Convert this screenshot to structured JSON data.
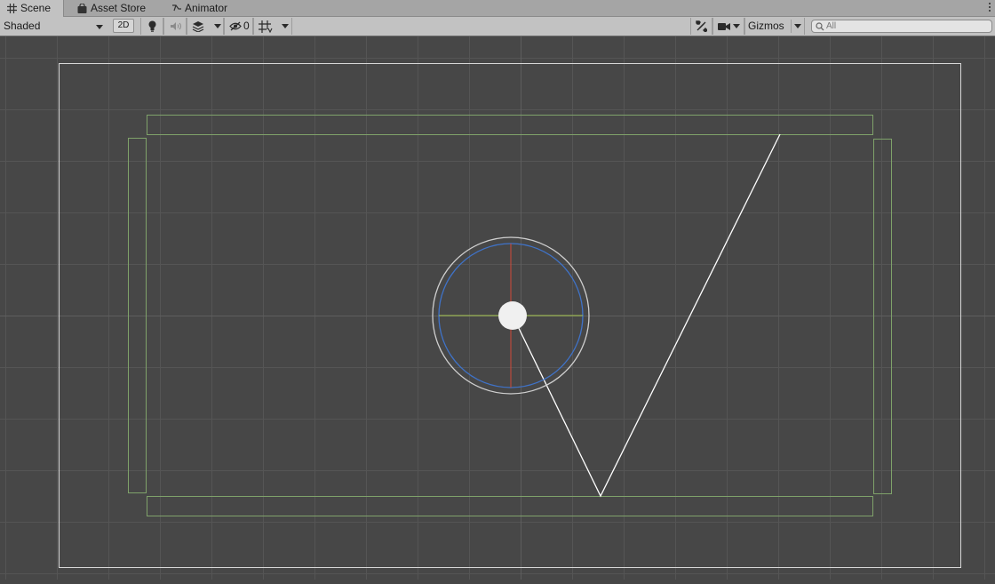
{
  "tabs": [
    {
      "label": "Scene",
      "icon": "grid-icon",
      "active": true
    },
    {
      "label": "Asset Store",
      "icon": "shopping-bag-icon",
      "active": false
    },
    {
      "label": "Animator",
      "icon": "animator-icon",
      "active": false
    }
  ],
  "toolbar": {
    "shading_mode": "Shaded",
    "mode_2d": "2D",
    "hidden_count": "0",
    "gizmos_label": "Gizmos",
    "search_placeholder": "All"
  },
  "icons": {
    "lighting": "lightbulb-icon",
    "audio": "speaker-icon",
    "effects": "layers-icon",
    "visibility": "eye-slash-icon",
    "grid": "grid-snap-icon",
    "tools": "tools-icon",
    "camera": "camera-icon",
    "search": "search-icon"
  },
  "colors": {
    "scene_background": "#474747",
    "grid_line": "#565656",
    "camera_frame": "#d8d8d8",
    "collider_outline": "#7fa26a",
    "circle_outer": "#cfcfcf",
    "circle_inner": "#3f73c9",
    "axis_x": "#a8c850",
    "axis_y": "#d04a3a",
    "ball": "#f0f0f0",
    "trajectory": "#ffffff"
  }
}
